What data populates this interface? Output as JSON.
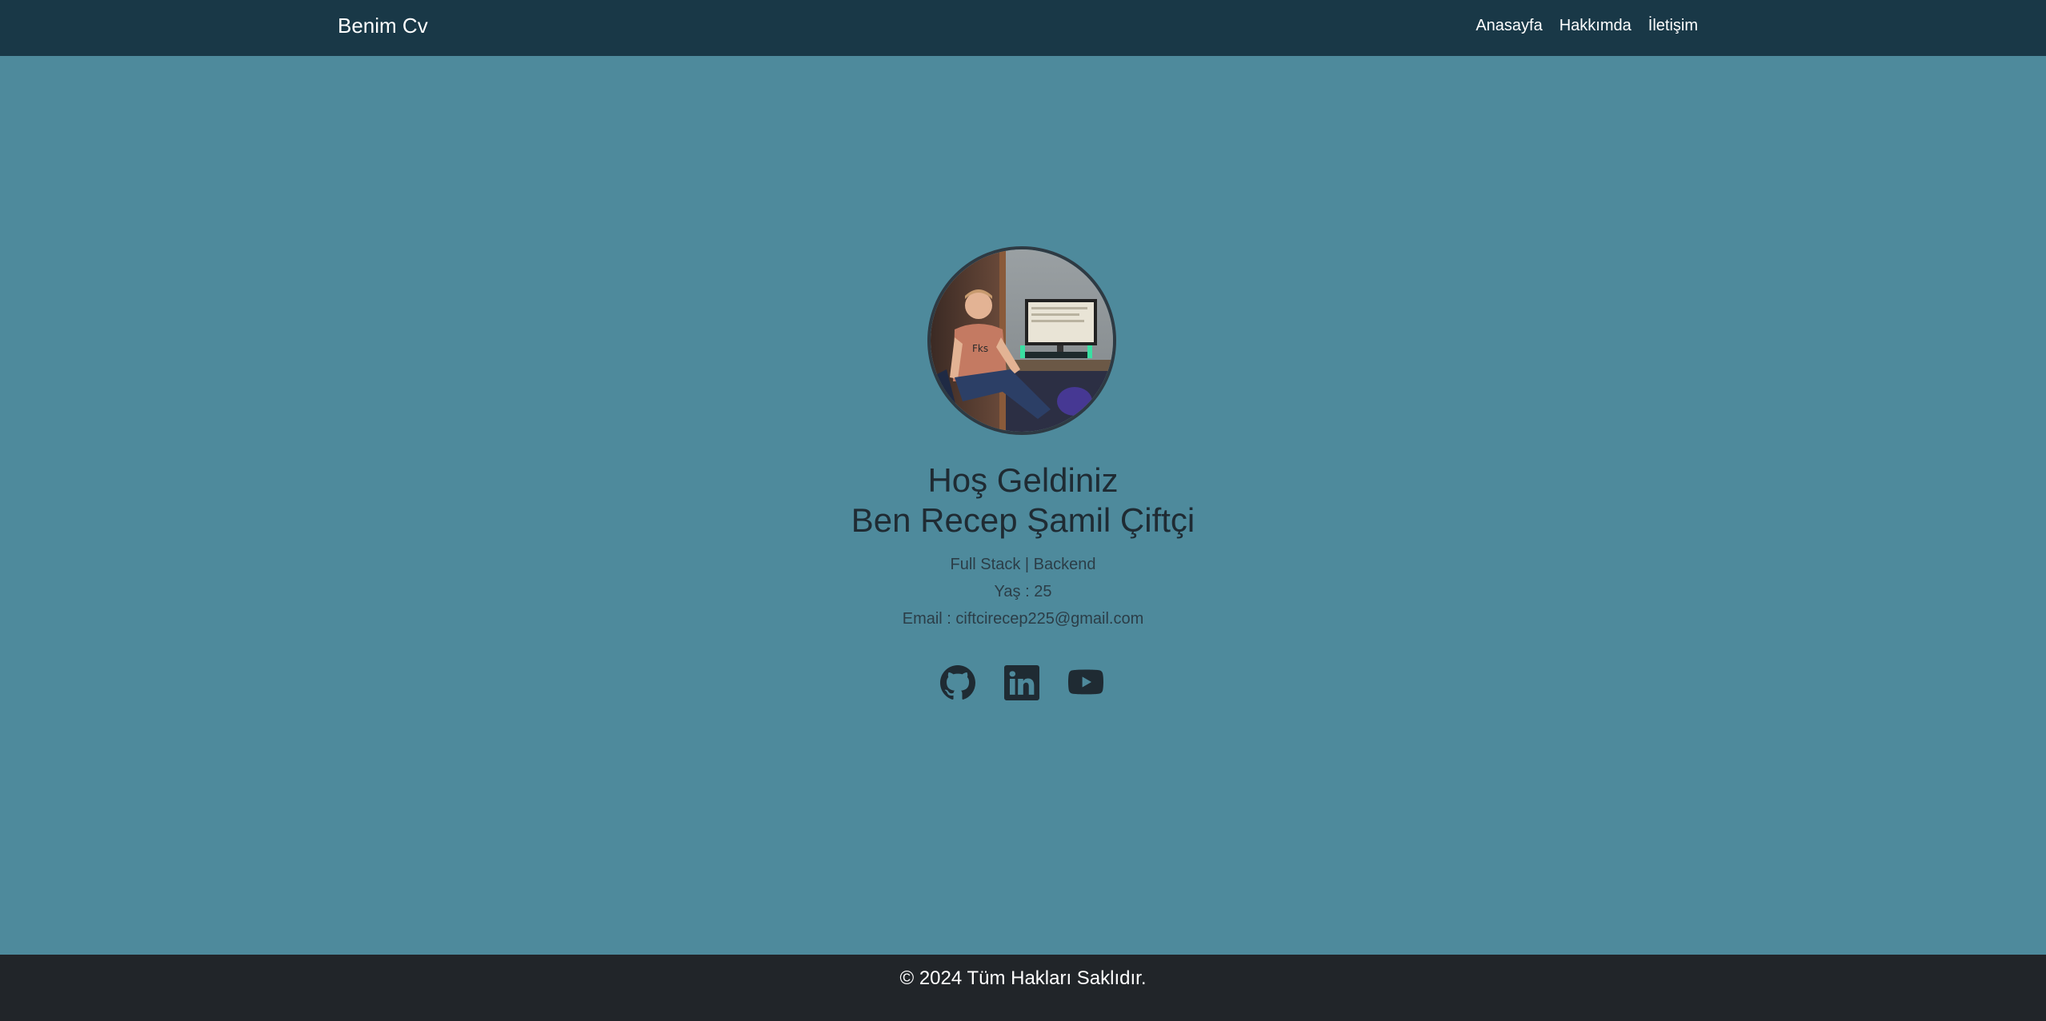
{
  "navbar": {
    "brand": "Benim Cv",
    "links": [
      "Anasayfa",
      "Hakkımda",
      "İletişim"
    ]
  },
  "hero": {
    "welcome": "Hoş Geldiniz",
    "name": "Ben Recep Şamil Çiftçi",
    "role": "Full Stack | Backend",
    "age": "Yaş : 25",
    "email": "Email : ciftcirecep225@gmail.com"
  },
  "socials": [
    {
      "icon": "github-icon"
    },
    {
      "icon": "linkedin-icon"
    },
    {
      "icon": "youtube-icon"
    }
  ],
  "footer": {
    "text": "© 2024 Tüm Hakları Saklıdır."
  },
  "colors": {
    "navbar_bg": "#193847",
    "page_bg": "#4e8a9c",
    "footer_bg": "#212529",
    "text_dark": "#1f2b33"
  }
}
